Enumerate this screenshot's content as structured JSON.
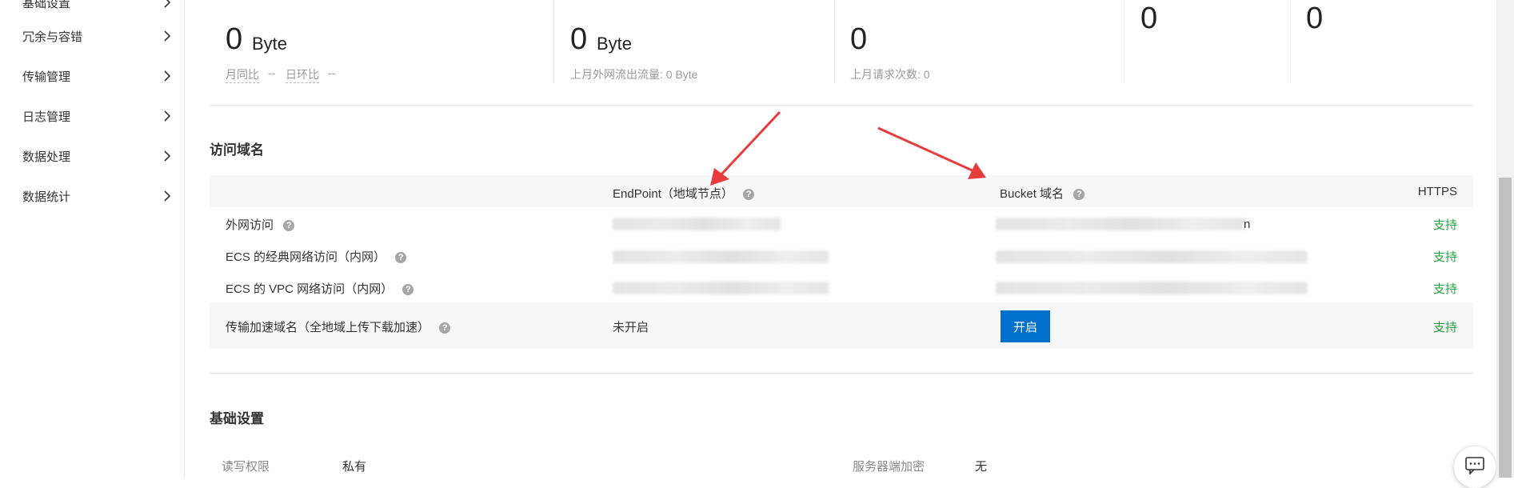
{
  "sidebar": {
    "items": [
      {
        "label": "基础设置"
      },
      {
        "label": "冗余与容错"
      },
      {
        "label": "传输管理"
      },
      {
        "label": "日志管理"
      },
      {
        "label": "数据处理"
      },
      {
        "label": "数据统计"
      }
    ]
  },
  "stats": {
    "storage": {
      "value": "0",
      "unit": "Byte",
      "mom_label": "月同比",
      "mom_value": "--",
      "dod_label": "日环比",
      "dod_value": "--"
    },
    "traffic": {
      "value": "0",
      "unit": "Byte",
      "sub": "上月外网流出流量: 0 Byte"
    },
    "requests": {
      "value": "0",
      "sub": "上月请求次数:  0"
    },
    "col4": {
      "value": "0"
    },
    "col5": {
      "value": "0"
    }
  },
  "domains": {
    "title": "访问域名",
    "headers": {
      "endpoint": "EndPoint（地域节点）",
      "bucket": "Bucket 域名",
      "https": "HTTPS"
    },
    "rows": [
      {
        "label": "外网访问",
        "https": "支持"
      },
      {
        "label": "ECS 的经典网络访问（内网）",
        "https": "支持"
      },
      {
        "label": "ECS 的 VPC 网络访问（内网）",
        "https": "支持"
      },
      {
        "label": "传输加速域名（全地域上传下载加速）",
        "endpoint": "未开启",
        "button": "开启",
        "https": "支持"
      }
    ],
    "partial_text": "n",
    "help_glyph": "?"
  },
  "basic": {
    "title": "基础设置",
    "acl_label": "读写权限",
    "acl_value": "私有",
    "encryption_label": "服务器端加密",
    "encryption_value": "无"
  },
  "colors": {
    "accent": "#0070cc",
    "support": "#23a047",
    "arrow": "#e63c3c"
  },
  "icons": [
    "chevron-right-icon",
    "help-icon",
    "feedback-chat-icon",
    "red-arrow-annotation"
  ]
}
